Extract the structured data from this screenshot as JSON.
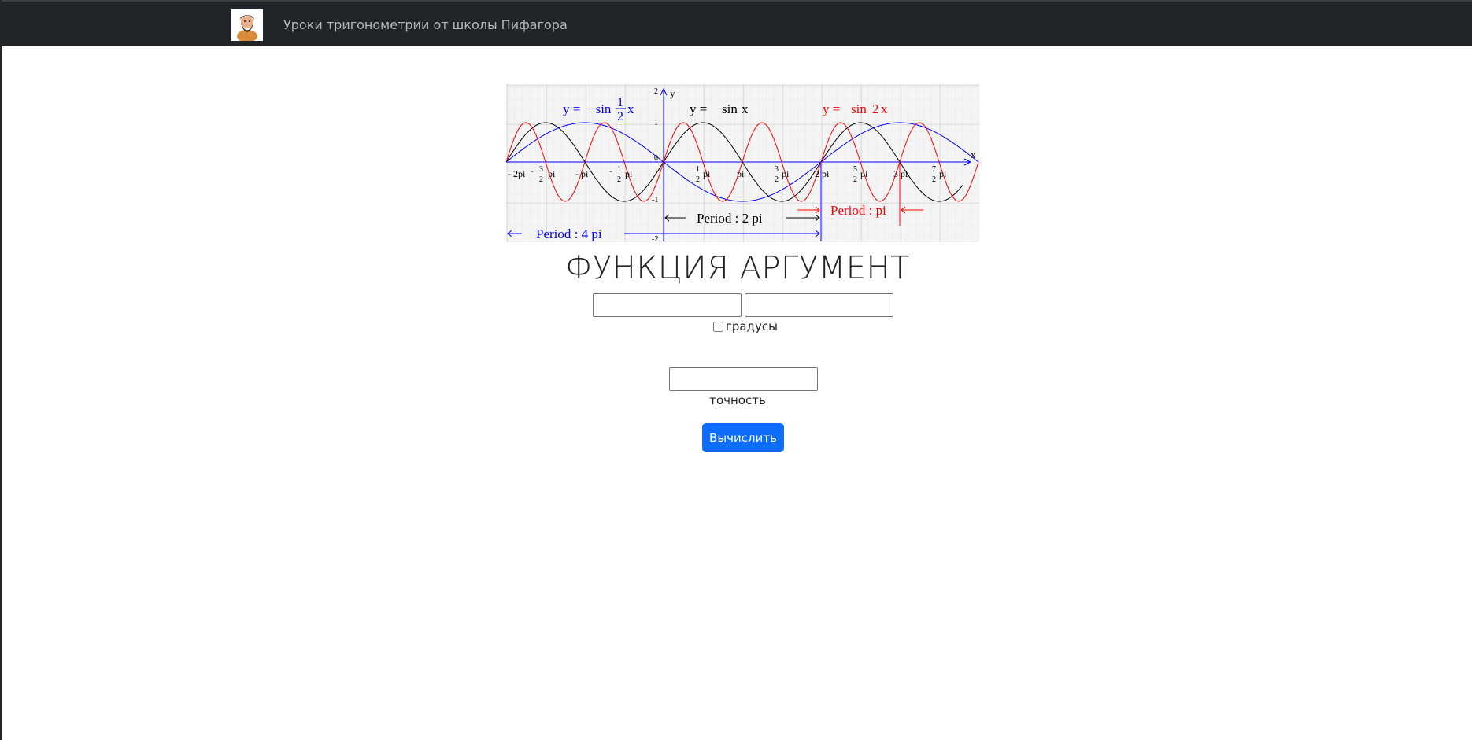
{
  "navbar": {
    "title": "Уроки тригонометрии от школы Пифагора",
    "logo_icon": "bearded-man-avatar-icon",
    "background": "#212529"
  },
  "graph": {
    "labels": {
      "y_axis": "y",
      "x_axis": "x",
      "y_ticks": [
        "2",
        "1",
        "0",
        "-1",
        "-2"
      ],
      "eq_half": [
        "y = ",
        "−sin",
        "1",
        "2",
        " x"
      ],
      "eq_sin": [
        "y = ",
        "sin",
        " x"
      ],
      "eq_sin2": [
        "y = ",
        "sin",
        "2",
        "x"
      ],
      "period_4pi": "Period : 4 pi",
      "period_2pi": "Period : 2 pi",
      "period_pi": "Period : pi",
      "x_ticks": [
        "- 2pi",
        "-",
        "3",
        "2",
        "pi",
        "- pi",
        "-",
        "1",
        "2",
        "pi",
        "1",
        "2",
        "pi",
        "pi",
        "3",
        "2",
        "pi",
        "2 pi",
        "5",
        "2",
        "pi",
        "3 pi",
        "7",
        "2",
        "pi"
      ]
    },
    "colors": {
      "sin_x": "#000000",
      "sin_2x": "#ff0000",
      "neg_sin_half_x": "#0000ff",
      "grid": "#c8c8c8"
    }
  },
  "form": {
    "heading": "ФУНКЦИЯ АРГУМЕНТ",
    "function_value": "",
    "argument_value": "",
    "degrees_label": "градусы",
    "degrees_checked": false,
    "precision_value": "",
    "precision_label": "точность",
    "submit_label": "Вычислить",
    "accent": "#0d6efd"
  }
}
